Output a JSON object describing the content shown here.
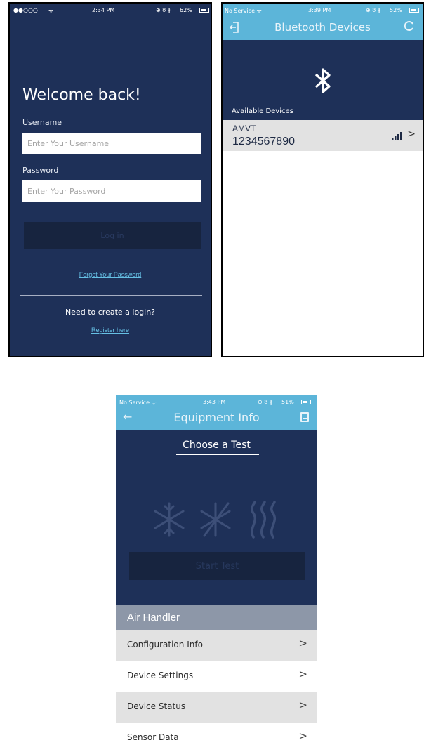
{
  "login_screen": {
    "status": {
      "carrier": "●●○○○",
      "wifi": "ᯤ",
      "time": "2:34 PM",
      "icons": "⊕ ʊ ∦",
      "battery": "62%"
    },
    "welcome": "Welcome back!",
    "username_label": "Username",
    "username_placeholder": "Enter Your Username",
    "password_label": "Password",
    "password_placeholder": "Enter Your Password",
    "login_button": "Log in",
    "forgot_link": "Forgot Your Password",
    "need_login": "Need to create a login?",
    "register_link": "Register here"
  },
  "bluetooth_screen": {
    "status": {
      "carrier": "No Service ᯤ",
      "time": "3:39 PM",
      "icons": "⊕ ʊ ∦",
      "battery": "52%"
    },
    "title": "Bluetooth Devices",
    "back_icon": "exit-icon",
    "refresh_icon": "refresh-icon",
    "available_label": "Available Devices",
    "devices": [
      {
        "name": "AMVT",
        "id": "1234567890"
      }
    ]
  },
  "equipment_screen": {
    "status": {
      "carrier": "No Service ᯤ",
      "time": "3:43 PM",
      "icons": "⊕ ʊ ∦",
      "battery": "51%"
    },
    "title": "Equipment Info",
    "choose_test": "Choose a Test",
    "test_icons": [
      "snowflake-icon",
      "defrost-icon",
      "heat-icon"
    ],
    "start_button": "Start Test",
    "section_title": "Air Handler",
    "menu_items": [
      {
        "label": "Configuration Info"
      },
      {
        "label": "Device Settings"
      },
      {
        "label": "Device Status"
      },
      {
        "label": "Sensor Data"
      }
    ]
  },
  "colors": {
    "navy": "#1e3058",
    "dark_button": "#17243f",
    "header_blue": "#5cb5d9",
    "link_blue": "#66c0e4",
    "section_gray": "#8d97a8",
    "row_gray": "#e2e2e2"
  }
}
